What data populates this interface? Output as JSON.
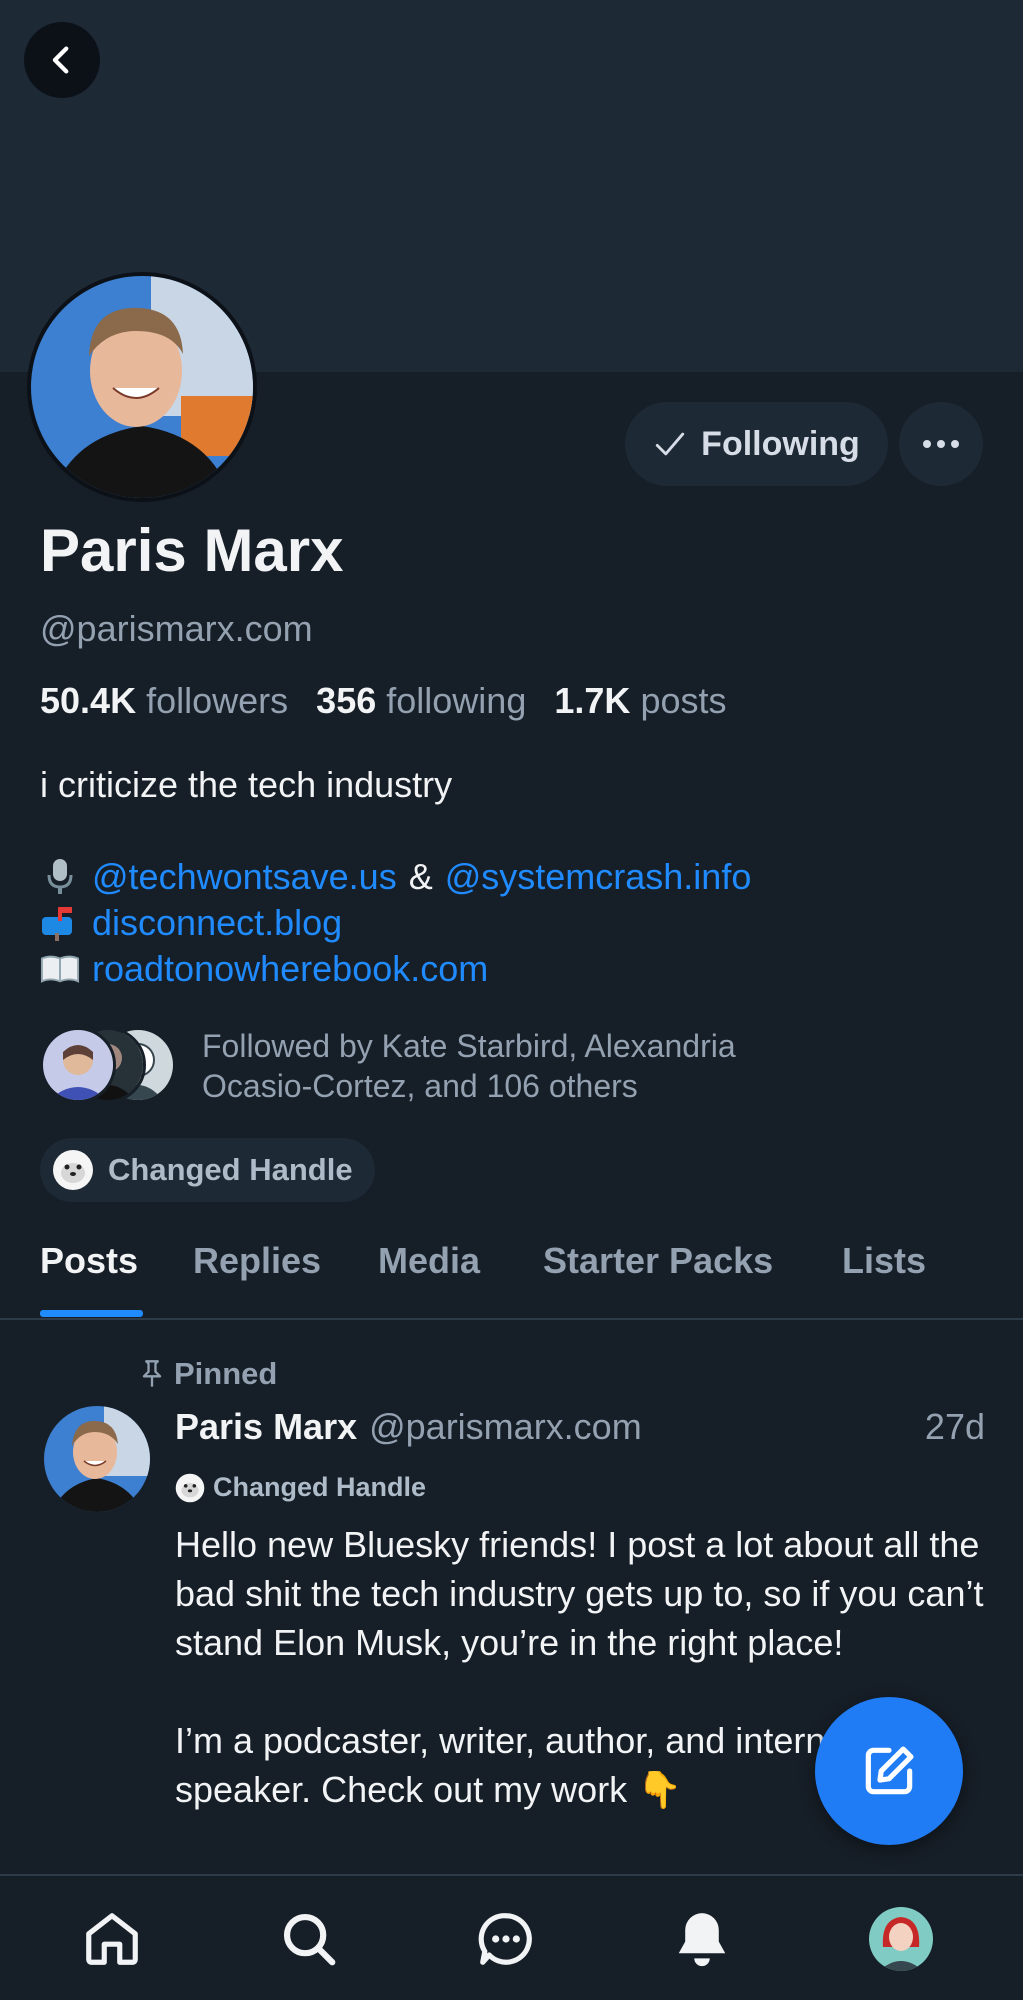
{
  "profile": {
    "display_name": "Paris Marx",
    "handle": "@parismarx.com",
    "follow_button_label": "Following",
    "stats": {
      "followers_count": "50.4K",
      "followers_label": "followers",
      "following_count": "356",
      "following_label": "following",
      "posts_count": "1.7K",
      "posts_label": "posts"
    },
    "bio_line": "i criticize the tech industry",
    "bio_links": {
      "podcast": "@techwontsave.us",
      "amp": "&",
      "podcast2": "@systemcrash.info",
      "blog": "disconnect.blog",
      "book": "roadtonowherebook.com"
    },
    "followed_by": "Followed by Kate Starbird, Alexandria Ocasio-Cortez, and 106 others",
    "label_chip": "Changed Handle"
  },
  "tabs": [
    "Posts",
    "Replies",
    "Media",
    "Starter Packs",
    "Lists"
  ],
  "pinned_post": {
    "pinned_label": "Pinned",
    "author_name": "Paris Marx",
    "author_handle": "@parismarx.com",
    "time": "27d",
    "label": "Changed Handle",
    "text": "Hello new Bluesky friends! I post a lot about all the bad shit the tech industry gets up to, so if you can’t stand Elon Musk, you’re in the right place!\n\nI’m a podcaster, writer, author, and international speaker. Check out my work 👇"
  },
  "colors": {
    "accent": "#208bfe",
    "background": "#161e27",
    "banner": "#1e2936",
    "fab": "#1f7cf5"
  },
  "icons": {
    "back": "chevron-left-icon",
    "follow_check": "check-icon",
    "more": "ellipsis-icon",
    "pin": "pin-icon",
    "label": "seal-icon",
    "compose": "compose-icon",
    "nav": [
      "home-icon",
      "search-icon",
      "chat-icon",
      "bell-icon",
      "profile-avatar"
    ]
  }
}
